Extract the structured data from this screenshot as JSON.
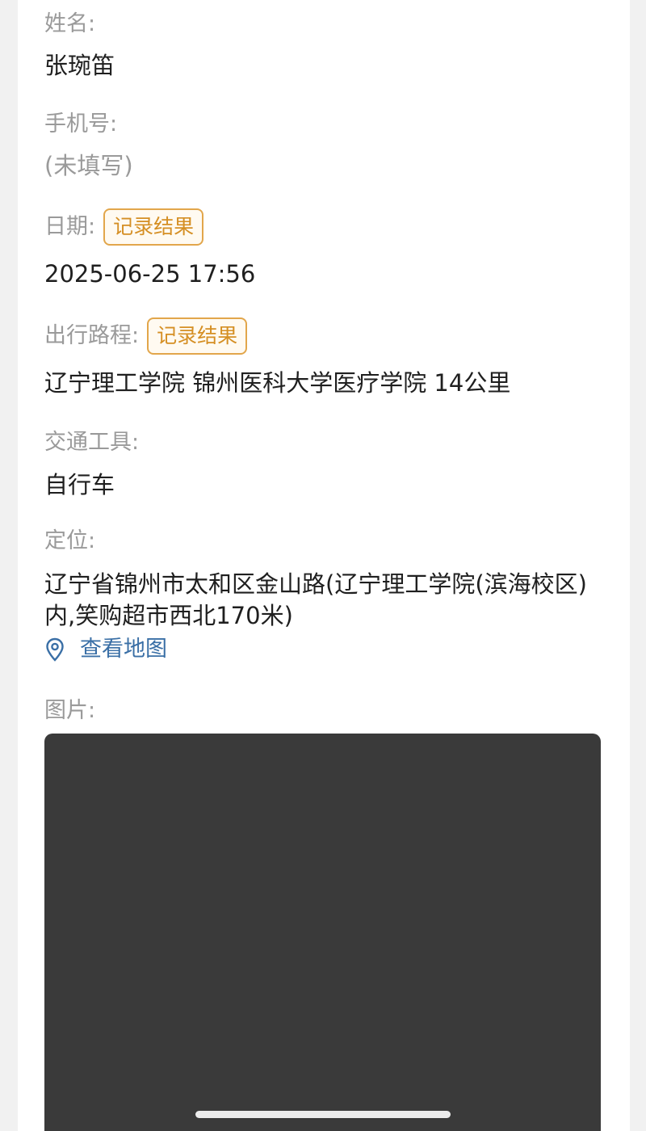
{
  "fields": {
    "name": {
      "label": "姓名:",
      "value": "张琬笛"
    },
    "phone": {
      "label": "手机号:",
      "value": "(未填写)"
    },
    "date": {
      "label": "日期:",
      "tag": "记录结果",
      "value": "2025-06-25 17:56"
    },
    "route": {
      "label": "出行路程:",
      "tag": "记录结果",
      "value": "辽宁理工学院 锦州医科大学医疗学院 14公里"
    },
    "transport": {
      "label": "交通工具:",
      "value": "自行车"
    },
    "location": {
      "label": "定位:",
      "value": "辽宁省锦州市太和区金山路(辽宁理工学院(滨海校区)内,笑购超市西北170米)",
      "map_link": "查看地图",
      "map_icon": "location-pin-icon"
    },
    "photo": {
      "label": "图片:"
    }
  },
  "colors": {
    "label": "#9a9a9a",
    "value": "#1f1f1f",
    "tag": "#d58f24",
    "link": "#3a6fa6",
    "photo": "#3a3a3a"
  }
}
